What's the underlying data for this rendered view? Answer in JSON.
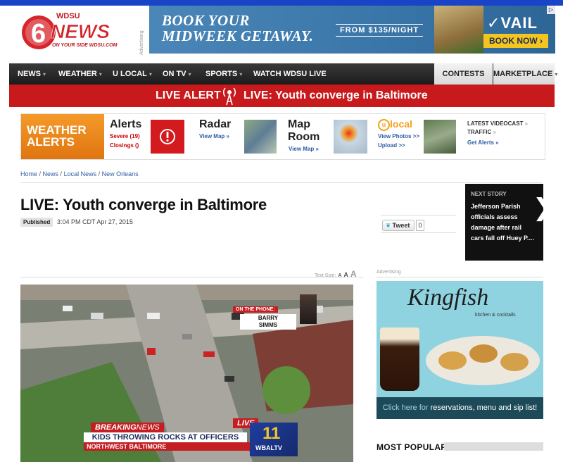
{
  "logo": {
    "channel": "6",
    "brand": "WDSU NEWS",
    "tagline": "ON YOUR SIDE  WDSU.COM"
  },
  "ads": {
    "vertical_label": "Advertising",
    "banner": {
      "headline_1": "BOOK YOUR",
      "headline_2": "MIDWEEK GETAWAY.",
      "price": "FROM $135/NIGHT",
      "brand": "VAIL",
      "button": "BOOK NOW ›"
    },
    "sidebar_label": "Advertising",
    "kingfish": {
      "brand": "Kingfish",
      "subtitle": "kitchen & cocktails",
      "cta_a": "Click here for",
      "cta_b": " reservations, menu and sip list!"
    }
  },
  "nav": {
    "items": [
      {
        "label": "NEWS"
      },
      {
        "label": "WEATHER"
      },
      {
        "label": "U LOCAL"
      },
      {
        "label": "ON TV"
      },
      {
        "label": "SPORTS"
      },
      {
        "label": "WATCH WDSU LIVE"
      }
    ],
    "contests": "CONTESTS",
    "marketplace": "MARKETPLACE"
  },
  "live_alert": {
    "label": "LIVE ALERT",
    "text": "LIVE: Youth converge in Baltimore"
  },
  "widgets": {
    "weather_alerts_1": "WEATHER",
    "weather_alerts_2": "ALERTS",
    "alerts_title": "Alerts",
    "severe": "Severe (19)",
    "closings": "Closings ()",
    "radar_title": "Radar",
    "radar_link": "View Map »",
    "maproom_title_1": "Map",
    "maproom_title_2": "Room",
    "maproom_link": "View Map »",
    "ulocal_title": "local",
    "ulocal_link_1": "View Photos >>",
    "ulocal_link_2": "Upload >>",
    "videocast": "LATEST VIDEOCAST",
    "traffic": "TRAFFIC",
    "traffic_link": "Get Alerts »",
    "chevrons": "»"
  },
  "breadcrumb": [
    "Home",
    "News",
    "Local News",
    "New Orleans"
  ],
  "article": {
    "headline": "LIVE: Youth converge in Baltimore",
    "published_label": "Published",
    "date": "3:04 PM CDT Apr 27, 2015",
    "tweet_label": "Tweet",
    "tweet_count": "0",
    "text_size_label": "Text Size:"
  },
  "next_story": {
    "label": "NEXT STORY",
    "title": "Jefferson Parish officials assess damage after rail cars fall off Huey P....",
    "arrow": "❯"
  },
  "video": {
    "phone_label": "ON THE PHONE:",
    "phone_name_1": "BARRY",
    "phone_name_2": "SIMMS",
    "breaking_1": "BREAKING",
    "breaking_2": "NEWS",
    "live": "LIVE",
    "headline": "KIDS THROWING ROCKS AT OFFICERS",
    "location": "NORTHWEST BALTIMORE",
    "station_num": "11",
    "station": "WBALTV"
  },
  "most_popular": "MOST POPULAR"
}
